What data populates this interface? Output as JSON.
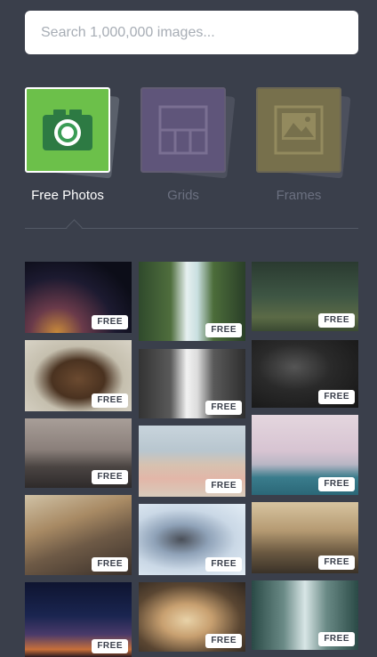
{
  "search": {
    "placeholder": "Search 1,000,000 images..."
  },
  "categories": [
    {
      "label": "Free Photos",
      "icon": "camera-icon",
      "color": "#6cc04a",
      "active": true
    },
    {
      "label": "Grids",
      "icon": "grid-layout-icon",
      "color": "#5f557a",
      "active": false
    },
    {
      "label": "Frames",
      "icon": "photo-frame-icon",
      "color": "#77704c",
      "active": false
    }
  ],
  "badge": "FREE",
  "images": [
    {
      "subject": "milky-way"
    },
    {
      "subject": "waterfall-green"
    },
    {
      "subject": "forest-path"
    },
    {
      "subject": "bear"
    },
    {
      "subject": "waterfall-bw"
    },
    {
      "subject": "diver"
    },
    {
      "subject": "mountain-cliff"
    },
    {
      "subject": "beach-sunbathers"
    },
    {
      "subject": "golden-gate-bridge"
    },
    {
      "subject": "typewriter"
    },
    {
      "subject": "coin-binoculars"
    },
    {
      "subject": "misty-hills"
    },
    {
      "subject": "night-horizon"
    },
    {
      "subject": "pastry"
    },
    {
      "subject": "bridge-underside"
    }
  ]
}
